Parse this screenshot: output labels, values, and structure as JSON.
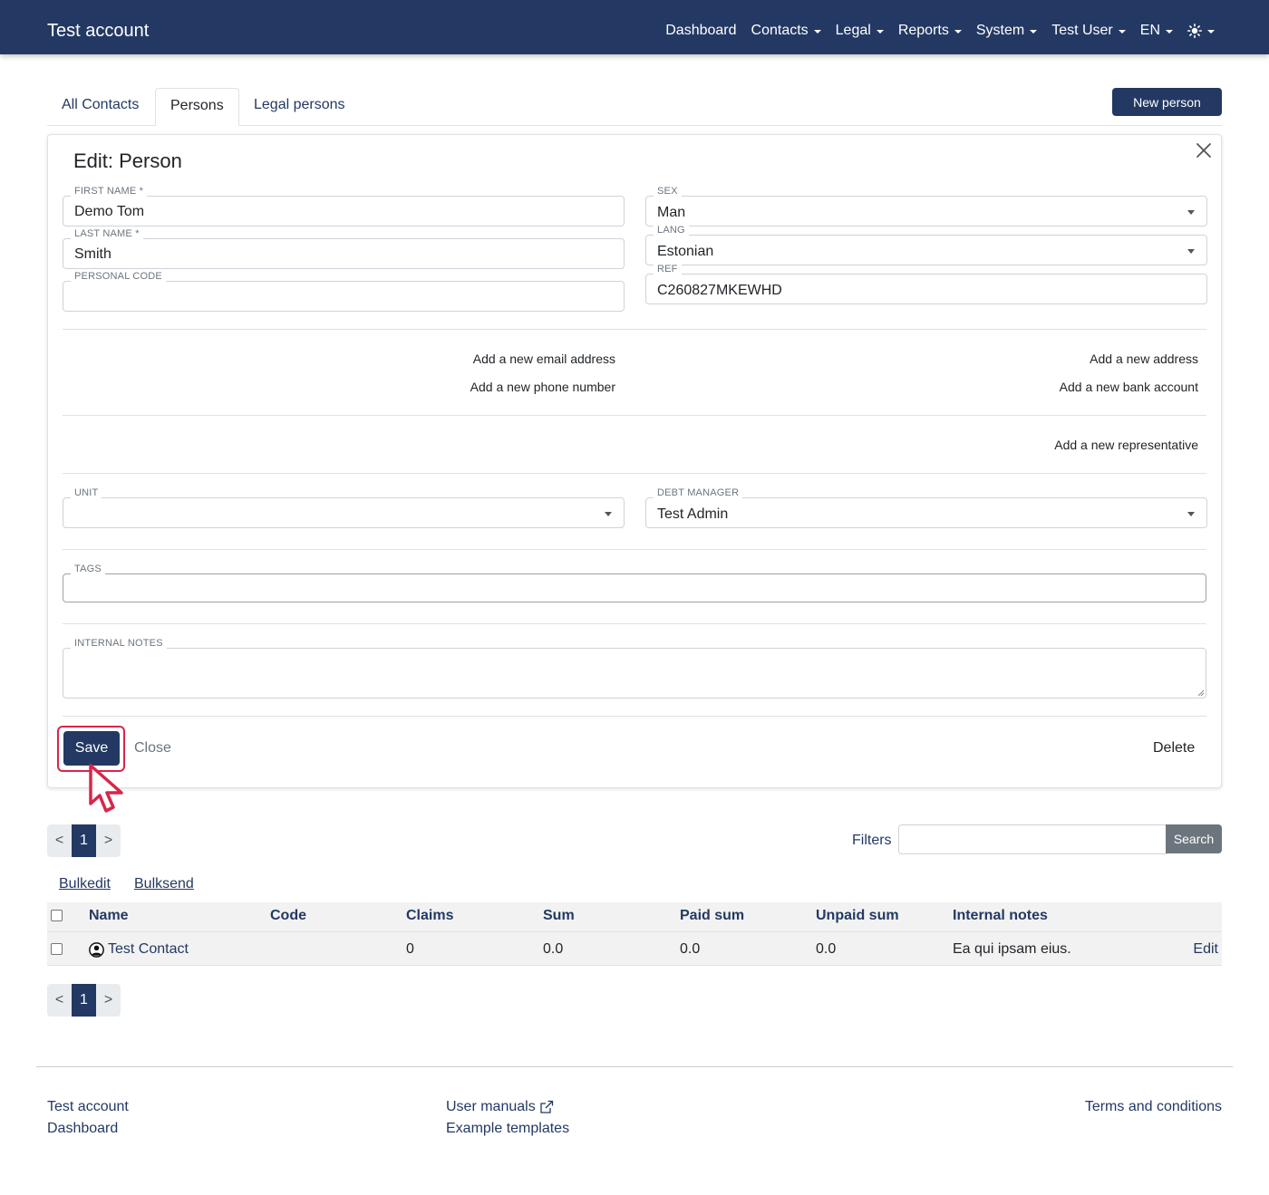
{
  "navbar": {
    "brand": "Test account",
    "items": [
      {
        "label": "Dashboard",
        "dropdown": false
      },
      {
        "label": "Contacts",
        "dropdown": true
      },
      {
        "label": "Legal",
        "dropdown": true
      },
      {
        "label": "Reports",
        "dropdown": true
      },
      {
        "label": "System",
        "dropdown": true
      },
      {
        "label": "Test User",
        "dropdown": true
      },
      {
        "label": "EN",
        "dropdown": true
      }
    ],
    "theme_icon": "sun-icon"
  },
  "tabs": [
    {
      "label": "All Contacts",
      "active": false
    },
    {
      "label": "Persons",
      "active": true
    },
    {
      "label": "Legal persons",
      "active": false
    }
  ],
  "new_person_label": "New person",
  "form": {
    "title": "Edit: Person",
    "first_name": {
      "label": "FIRST NAME *",
      "value": "Demo Tom"
    },
    "last_name": {
      "label": "LAST NAME *",
      "value": "Smith"
    },
    "personal_code": {
      "label": "PERSONAL CODE",
      "value": ""
    },
    "sex": {
      "label": "SEX",
      "value": "Man"
    },
    "lang": {
      "label": "LANG",
      "value": "Estonian"
    },
    "ref": {
      "label": "REF",
      "value": "C260827MKEWHD"
    },
    "add_email": "Add a new email address",
    "add_phone": "Add a new phone number",
    "add_address": "Add a new address",
    "add_bank": "Add a new bank account",
    "add_representative": "Add a new representative",
    "unit": {
      "label": "UNIT",
      "value": ""
    },
    "debt_manager": {
      "label": "DEBT MANAGER",
      "value": "Test Admin"
    },
    "tags": {
      "label": "TAGS",
      "value": ""
    },
    "internal_notes": {
      "label": "INTERNAL NOTES",
      "value": ""
    },
    "save_label": "Save",
    "close_label": "Close",
    "delete_label": "Delete"
  },
  "pagination": {
    "prev": "<",
    "current": "1",
    "next": ">"
  },
  "filters": {
    "label": "Filters",
    "value": "",
    "search_label": "Search"
  },
  "bulk": {
    "edit": "Bulkedit",
    "send": "Bulksend"
  },
  "table": {
    "headers": [
      "Name",
      "Code",
      "Claims",
      "Sum",
      "Paid sum",
      "Unpaid sum",
      "Internal notes"
    ],
    "rows": [
      {
        "name": "Test Contact",
        "code": "",
        "claims": "0",
        "sum": "0.0",
        "paid_sum": "0.0",
        "unpaid_sum": "0.0",
        "internal_notes": "Ea qui ipsam eius.",
        "edit": "Edit"
      }
    ]
  },
  "footer": {
    "col1": [
      "Test account",
      "Dashboard"
    ],
    "col2": [
      "User manuals",
      "Example templates"
    ],
    "col3": [
      "Terms and conditions"
    ]
  },
  "colors": {
    "primary": "#233963",
    "highlight": "#d9254a",
    "secondary": "#6c757d"
  }
}
